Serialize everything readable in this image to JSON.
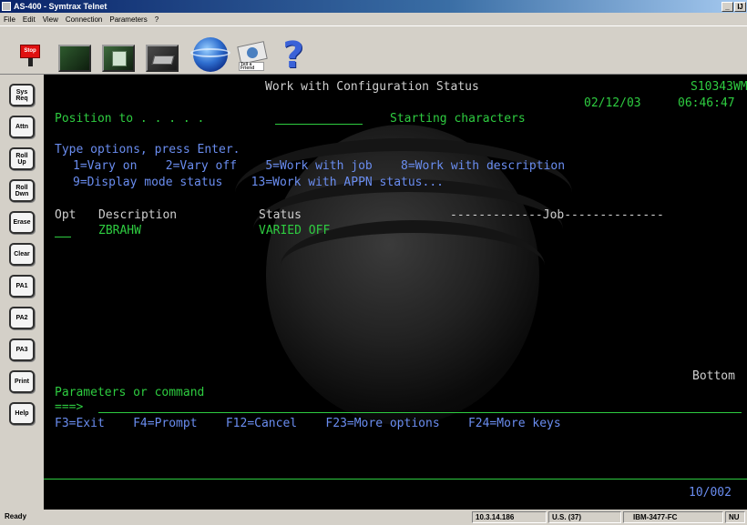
{
  "window": {
    "title": "AS-400 - Symtrax Telnet",
    "controls": [
      "_",
      "Ĳ"
    ]
  },
  "menu": [
    "File",
    "Edit",
    "View",
    "Connection",
    "Parameters",
    "?"
  ],
  "toolbar": {
    "stop_label": "Stop",
    "friend_label": "Tell a Friend",
    "help_glyph": "?",
    "icons": [
      "stop-sign-icon",
      "blank-screen-icon",
      "document-icon",
      "printer-icon",
      "globe-icon",
      "tell-a-friend-icon",
      "help-icon"
    ]
  },
  "keys": [
    "Sys Req",
    "Attn",
    "Roll Up",
    "Roll Dwn",
    "Erase",
    "Clear",
    "PA1",
    "PA2",
    "PA3",
    "Print",
    "Help"
  ],
  "screen": {
    "title": "Work with Configuration Status",
    "system_name": "S10343WM",
    "date": "02/12/03",
    "time": "06:46:47",
    "position_to_label": "Position to . . . . .",
    "starting_chars_label": "Starting characters",
    "instructions": "Type options, press Enter.",
    "options_line1": "1=Vary on    2=Vary off    5=Work with job    8=Work with description",
    "options_line2": "9=Display mode status    13=Work with APPN status...",
    "col_opt": "Opt",
    "col_description": "Description",
    "col_status": "Status",
    "col_job": "-------------Job--------------",
    "rows": [
      {
        "description": "ZBRAHW",
        "status": "VARIED OFF"
      }
    ],
    "bottom_label": "Bottom",
    "params_label": "Parameters or command",
    "prompt": "===>",
    "fkeys": "F3=Exit    F4=Prompt    F12=Cancel    F23=More options    F24=More keys",
    "cursor_pos": "10/002"
  },
  "status": {
    "ready": "Ready",
    "ip": "10.3.14.186",
    "codepage": "U.S. (37)",
    "terminal": "IBM-3477-FC",
    "num": "NU"
  },
  "colors": {
    "terminal_bg": "#000000",
    "text_white": "#cfcfcf",
    "text_green": "#2ecc40",
    "text_blue": "#6a8df0",
    "titlebar": "#0a246a"
  }
}
